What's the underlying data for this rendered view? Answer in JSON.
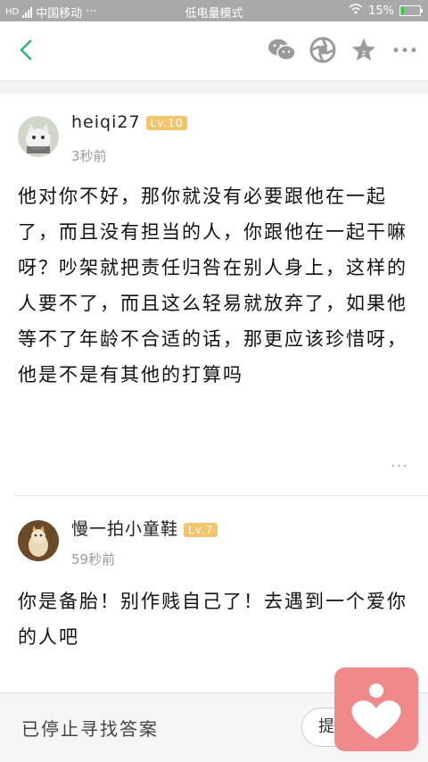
{
  "status_bar": {
    "carrier": "中国移动",
    "carrier_prefix": "HD",
    "dots": "···",
    "center_text": "低电量模式",
    "battery_percent": "15%",
    "battery_level": 0.15
  },
  "toolbar": {
    "back_icon": "chevron-left-icon",
    "icons": [
      "wechat-icon",
      "moments-icon",
      "star-icon",
      "more-icon"
    ]
  },
  "posts": [
    {
      "username": "heiqi27",
      "level": "Lv.10",
      "time": "3秒前",
      "content": "他对你不好，那你就没有必要跟他在一起了，而且没有担当的人，你跟他在一起干嘛呀？吵架就把责任归咎在别人身上，这样的人要不了，而且这么轻易就放弃了，如果他等不了年龄不合适的话，那更应该珍惜呀，他是不是有其他的打算吗",
      "more": "···"
    },
    {
      "username": "慢一拍小童鞋",
      "level": "Lv.7",
      "time": "59秒前",
      "content": "你是备胎！别作贱自己了！去遇到一个爱你的人吧"
    }
  ],
  "bottom_bar": {
    "stopped_text": "已停止寻找答案",
    "ask_button": "提"
  },
  "colors": {
    "accent_green": "#2bb673",
    "level_badge": "#f3c56b",
    "float_app": "#f08a8a"
  }
}
